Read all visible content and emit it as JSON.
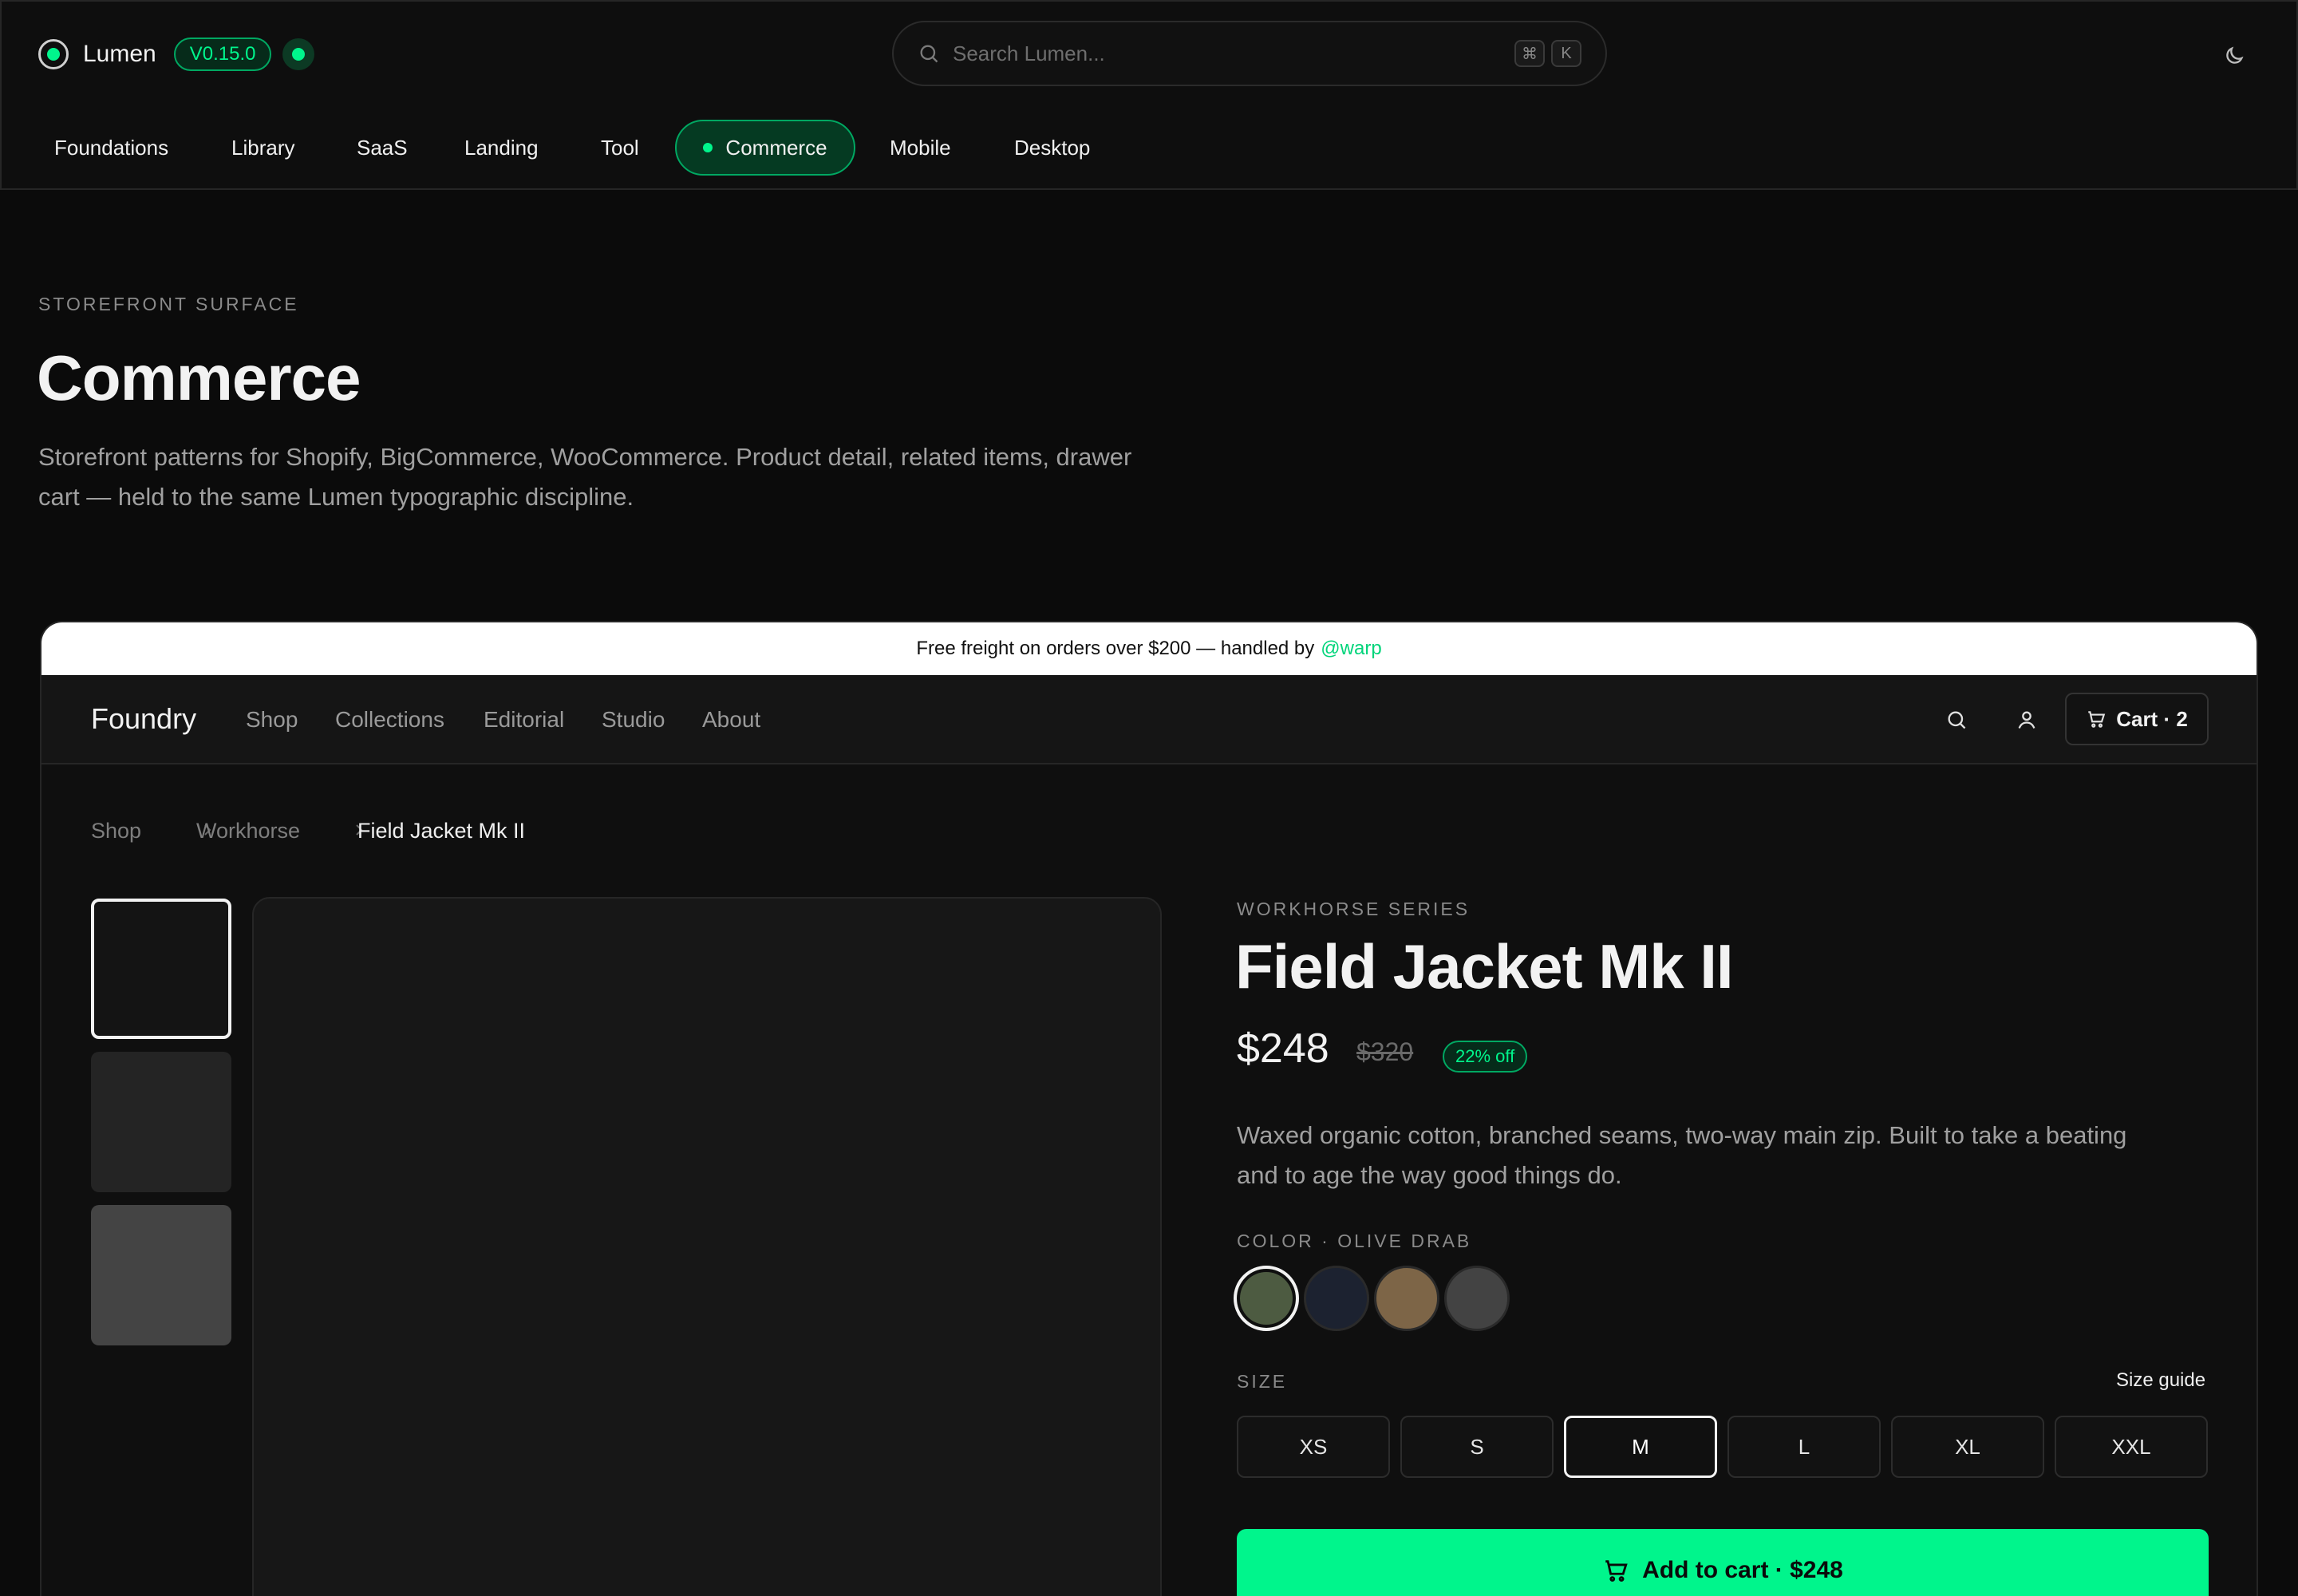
{
  "app": {
    "name": "Lumen",
    "version": "V0.15.0",
    "search_placeholder": "Search Lumen...",
    "shortcut_keys": [
      "⌘",
      "K"
    ]
  },
  "nav": {
    "items": [
      {
        "label": "Foundations"
      },
      {
        "label": "Library"
      },
      {
        "label": "SaaS"
      },
      {
        "label": "Landing"
      },
      {
        "label": "Tool"
      },
      {
        "label": "Commerce",
        "active": true
      },
      {
        "label": "Mobile"
      },
      {
        "label": "Desktop"
      }
    ]
  },
  "hero": {
    "eyebrow": "STOREFRONT SURFACE",
    "title": "Commerce",
    "description": "Storefront patterns for Shopify, BigCommerce, WooCommerce. Product detail, related items, drawer cart — held to the same Lumen typographic discipline."
  },
  "store": {
    "banner_text": "Free freight on orders over $200 — handled by",
    "banner_handle": "@warp",
    "logo": "Foundry",
    "links": [
      "Shop",
      "Collections",
      "Editorial",
      "Studio",
      "About"
    ],
    "cart_label": "Cart · 2",
    "breadcrumb": [
      "Shop",
      "Workhorse",
      "Field Jacket Mk II"
    ],
    "product": {
      "series": "WORKHORSE SERIES",
      "title": "Field Jacket Mk II",
      "price": "$248",
      "old_price": "$320",
      "discount": "22% off",
      "description": "Waxed organic cotton, branched seams, two-way main zip. Built to take a beating and to age the way good things do.",
      "color_label": "COLOR · OLIVE DRAB",
      "swatches": [
        {
          "color": "#4d5b41",
          "selected": true
        },
        {
          "color": "#1c2230"
        },
        {
          "color": "#7d6547"
        },
        {
          "color": "#434343"
        }
      ],
      "size_label": "SIZE",
      "size_guide": "Size guide",
      "sizes": [
        "XS",
        "S",
        "M",
        "L",
        "XL",
        "XXL"
      ],
      "selected_size": "M",
      "add_to_cart": "Add to cart · $248"
    },
    "thumbnails": [
      {
        "color": "#141414",
        "selected": true
      },
      {
        "color": "#242424"
      },
      {
        "color": "#444444"
      }
    ]
  },
  "colors": {
    "accent": "#00f58c",
    "background": "#0b0b0b"
  }
}
